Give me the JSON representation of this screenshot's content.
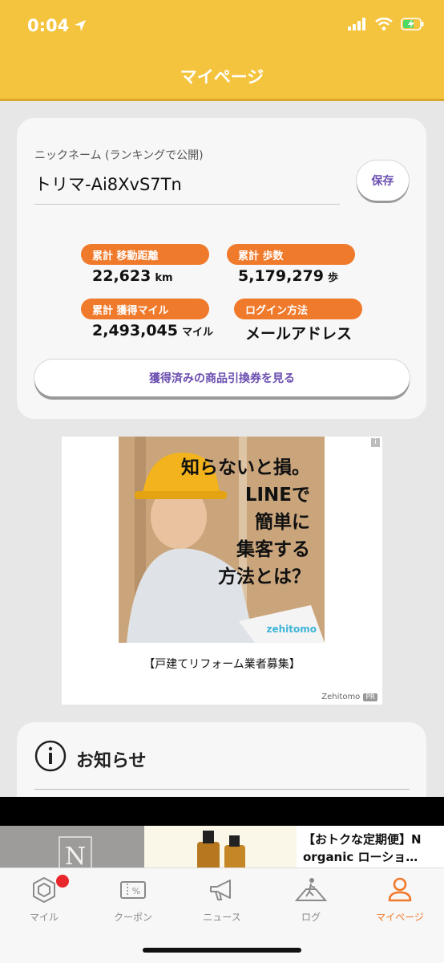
{
  "status_bar": {
    "time": "0:04"
  },
  "header": {
    "title": "マイページ"
  },
  "profile": {
    "nickname_label": "ニックネーム (ランキングで公開)",
    "nickname": "トリマ-Ai8XvS7Tn",
    "save_label": "保存",
    "stats": [
      {
        "label": "累計 移動距離",
        "value": "22,623",
        "unit": "km"
      },
      {
        "label": "累計 歩数",
        "value": "5,179,279",
        "unit": "歩"
      },
      {
        "label": "累計 獲得マイル",
        "value": "2,493,045",
        "unit": "マイル"
      },
      {
        "label": "ログイン方法",
        "value": "メールアドレス",
        "unit": ""
      }
    ],
    "coupon_button": "獲得済みの商品引換券を見る"
  },
  "ad": {
    "copy_lines": [
      "知らないと損。",
      "LINEで",
      "簡単に",
      "集客する",
      "方法とは？"
    ],
    "brand": "zehitomo",
    "caption": "【戸建てリフォーム業者募集】",
    "sponsor": "Zehitomo",
    "pr": "PR",
    "info": "i"
  },
  "news": {
    "title": "お知らせ"
  },
  "banner": {
    "logo_letter": "N",
    "text": "【おトクな定期便】N organic ローショ…"
  },
  "tabs": [
    {
      "label": "マイル",
      "icon": "gem-icon",
      "badge": true
    },
    {
      "label": "クーポン",
      "icon": "coupon-icon"
    },
    {
      "label": "ニュース",
      "icon": "megaphone-icon"
    },
    {
      "label": "ログ",
      "icon": "walking-icon"
    },
    {
      "label": "マイページ",
      "icon": "person-icon",
      "active": true
    }
  ],
  "colors": {
    "header": "#f5c43f",
    "accent": "#f07a2b",
    "button_text": "#6b4eb0",
    "badge": "#e8262b"
  }
}
